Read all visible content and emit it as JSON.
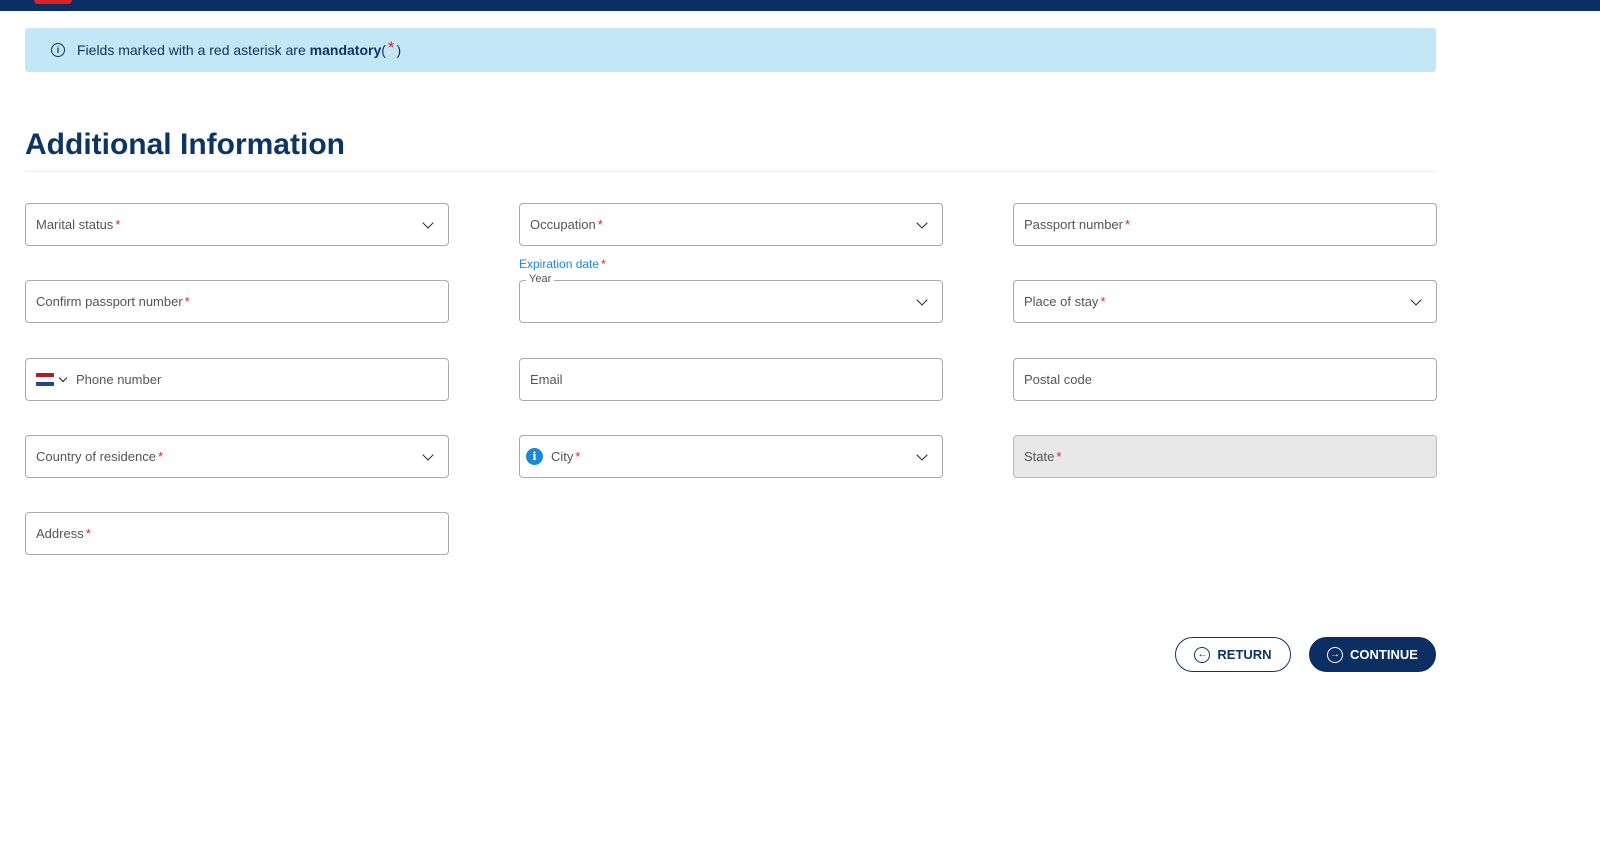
{
  "banner": {
    "text": "Fields marked with a red asterisk are ",
    "bold": "mandatory",
    "open": "(",
    "asterisk": "*",
    "close": ")"
  },
  "section": {
    "title": "Additional Information"
  },
  "fields": {
    "marital_status": {
      "label": "Marital status",
      "req": "*"
    },
    "occupation": {
      "label": "Occupation",
      "req": "*"
    },
    "passport_number": {
      "label": "Passport number",
      "req": "*"
    },
    "confirm_passport": {
      "label": "Confirm passport number",
      "req": "*"
    },
    "expiration_date": {
      "label": "Expiration date",
      "req": "*",
      "year_legend": "Year"
    },
    "place_of_stay": {
      "label": "Place of stay",
      "req": "*"
    },
    "phone": {
      "placeholder": "Phone number"
    },
    "email": {
      "placeholder": "Email"
    },
    "postal_code": {
      "placeholder": "Postal code"
    },
    "country_of_residence": {
      "label": "Country of residence",
      "req": "*"
    },
    "city": {
      "label": "City",
      "req": "*",
      "info_glyph": "i"
    },
    "state": {
      "label": "State",
      "req": "*"
    },
    "address": {
      "label": "Address",
      "req": "*"
    }
  },
  "buttons": {
    "return": {
      "label": "RETURN",
      "icon": "←"
    },
    "continue": {
      "label": "CONTINUE",
      "icon": "→"
    }
  },
  "colors": {
    "navy": "#0b2f63",
    "banner_bg": "#c3e7f6",
    "required_red": "#d8232a",
    "link_blue": "#1a8ad4"
  },
  "icons": {
    "banner": "info-circle-icon",
    "dropdown": "chevron-down-icon",
    "phone_flag": "netherlands-flag-icon",
    "city": "info-icon",
    "return": "arrow-left-circle-icon",
    "continue": "arrow-right-circle-icon"
  }
}
